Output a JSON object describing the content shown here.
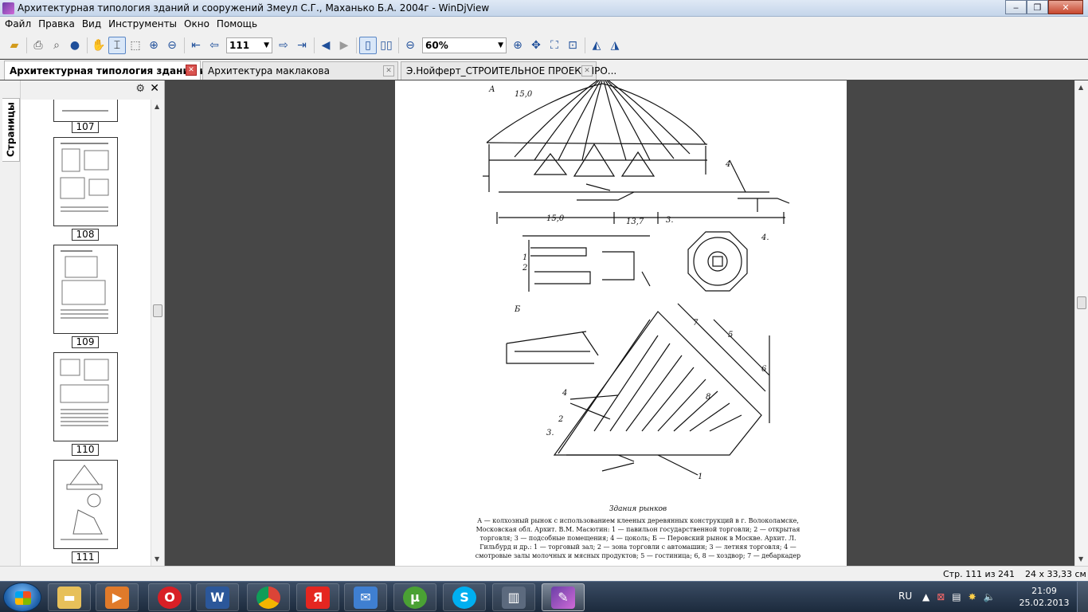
{
  "window": {
    "title": "Архитектурная типология зданий и сооружений Змеул С.Г., Маханько Б.А. 2004г - WinDjView",
    "minimize": "‒",
    "maximize": "❐",
    "close": "✕"
  },
  "menu": [
    "Файл",
    "Правка",
    "Вид",
    "Инструменты",
    "Окно",
    "Помощь"
  ],
  "toolbar": {
    "page_value": "111",
    "zoom_value": "60%"
  },
  "tabs": [
    {
      "label": "Архитектурная типология зданий и...",
      "active": true
    },
    {
      "label": "Архитектура маклакова",
      "active": false
    },
    {
      "label": "Э.Нойферт_СТРОИТЕЛЬНОЕ ПРОЕКТИРО...",
      "active": false
    }
  ],
  "sidebar": {
    "tab_label": "Страницы",
    "thumbnails": [
      "107",
      "108",
      "109",
      "110",
      "111"
    ]
  },
  "document": {
    "drawing_labels": {
      "section_a": "А",
      "section_b": "Б",
      "dim_1": "15,0",
      "dim_2": "13,7",
      "label_3": "3.",
      "label_4a": "4",
      "label_4b": "4.",
      "label_1": "1",
      "label_2": "2",
      "label_5": "5",
      "label_6": "6",
      "label_7": "7",
      "label_8": "8"
    },
    "caption_title": "Здания рынков",
    "caption_text": "А — колхозный рынок с использованием клееных деревянных конструкций в г. Волоколамске, Московская обл. Архит. В.М. Масютин: 1 — павильон государственной торговли; 2 — открытая торговля; 3 — подсобные помещения; 4 — цоколь; Б — Перовский рынок в Москве. Архит. Л. Гильбурд и др.: 1 — торговый зал; 2 — зона торговли с автомашин; 3 — летняя торговля; 4 — смотровые залы молочных и мясных продуктов; 5 — гостиница; 6, 8 — хоздвор; 7 — дебаркадер"
  },
  "status": {
    "page_info": "Стр. 111 из 241",
    "page_size": "24 x 33,33 см"
  },
  "taskbar": {
    "language": "RU",
    "time": "21:09",
    "date": "25.02.2013"
  }
}
